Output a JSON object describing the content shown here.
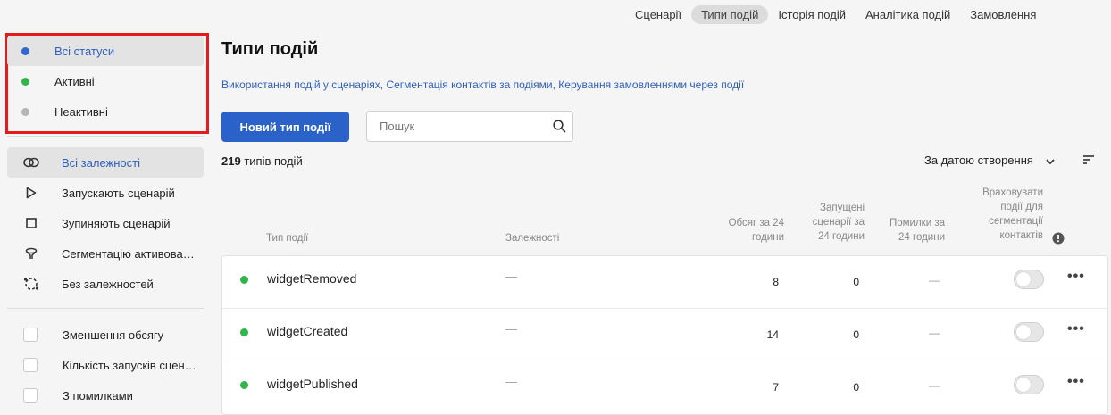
{
  "topnav": {
    "tabs": [
      {
        "label": "Сценарії",
        "active": false
      },
      {
        "label": "Типи подій",
        "active": true
      },
      {
        "label": "Історія подій",
        "active": false
      },
      {
        "label": "Аналітика подій",
        "active": false
      },
      {
        "label": "Замовлення",
        "active": false
      }
    ]
  },
  "sidebar": {
    "statuses": [
      {
        "label": "Всі статуси",
        "color": "#3366cc",
        "active": true
      },
      {
        "label": "Активні",
        "color": "#2fb54a",
        "active": false
      },
      {
        "label": "Неактивні",
        "color": "#b5b5b5",
        "active": false
      }
    ],
    "dependencies": [
      {
        "label": "Всі залежності",
        "icon": "link-icon",
        "active": true
      },
      {
        "label": "Запускають сценарій",
        "icon": "play-icon",
        "active": false
      },
      {
        "label": "Зупиняють сценарій",
        "icon": "stop-icon",
        "active": false
      },
      {
        "label": "Сегментацію активовано",
        "icon": "filter-funnel-icon",
        "active": false
      },
      {
        "label": "Без залежностей",
        "icon": "no-dependency-icon",
        "active": false
      }
    ],
    "filters": [
      {
        "label": "Зменшення обсягу"
      },
      {
        "label": "Кількість запусків сценаріїв"
      },
      {
        "label": "З помилками"
      }
    ]
  },
  "main": {
    "title": "Типи подій",
    "links": {
      "link1": "Використання подій у сценаріях",
      "link2": "Сегментація контактів за подіями",
      "link3": "Керування замовленнями через події"
    },
    "new_button": "Новий тип події",
    "search_placeholder": "Пошук",
    "count_number": "219",
    "count_text": "типів подій",
    "sort_label": "За датою створення",
    "columns": {
      "type": "Тип події",
      "deps": "Залежності",
      "volume_l1": "Обсяг за 24",
      "volume_l2": "години",
      "runs_l1": "Запущені",
      "runs_l2": "сценарії за",
      "runs_l3": "24 години",
      "errors_l1": "Помилки за",
      "errors_l2": "24 години",
      "seg_l1": "Враховувати",
      "seg_l2": "події для",
      "seg_l3": "сегментації",
      "seg_l4": "контактів"
    },
    "rows": [
      {
        "name": "widgetRemoved",
        "deps": "—",
        "volume": "8",
        "runs": "0",
        "errors": "—"
      },
      {
        "name": "widgetCreated",
        "deps": "—",
        "volume": "14",
        "runs": "0",
        "errors": "—"
      },
      {
        "name": "widgetPublished",
        "deps": "—",
        "volume": "7",
        "runs": "0",
        "errors": "—"
      }
    ]
  }
}
